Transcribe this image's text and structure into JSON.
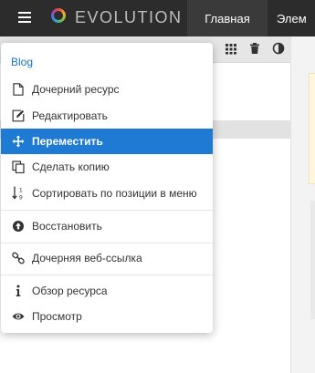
{
  "header": {
    "logo_text": "EVOLUTION",
    "nav_home": "Главная",
    "nav_elements": "Элем"
  },
  "context_menu": {
    "title": "Blog",
    "items": [
      {
        "label": "Дочерний ресурс",
        "icon": "file-icon",
        "active": false
      },
      {
        "label": "Редактировать",
        "icon": "edit-icon",
        "active": false
      },
      {
        "label": "Переместить",
        "icon": "move-icon",
        "active": true
      },
      {
        "label": "Сделать копию",
        "icon": "copy-icon",
        "active": false
      },
      {
        "label": "Сортировать по позиции в меню",
        "icon": "sort-numeric-icon",
        "active": false
      },
      {
        "label": "Восстановить",
        "icon": "restore-icon",
        "active": false
      },
      {
        "label": "Дочерняя веб-ссылка",
        "icon": "link-icon",
        "active": false
      },
      {
        "label": "Обзор ресурса",
        "icon": "info-icon",
        "active": false
      },
      {
        "label": "Просмотр",
        "icon": "eye-icon",
        "active": false
      }
    ]
  },
  "colors": {
    "topbar": "#2c2c2c",
    "accent": "#1f7ad3",
    "menu_title": "#1a73c8"
  }
}
